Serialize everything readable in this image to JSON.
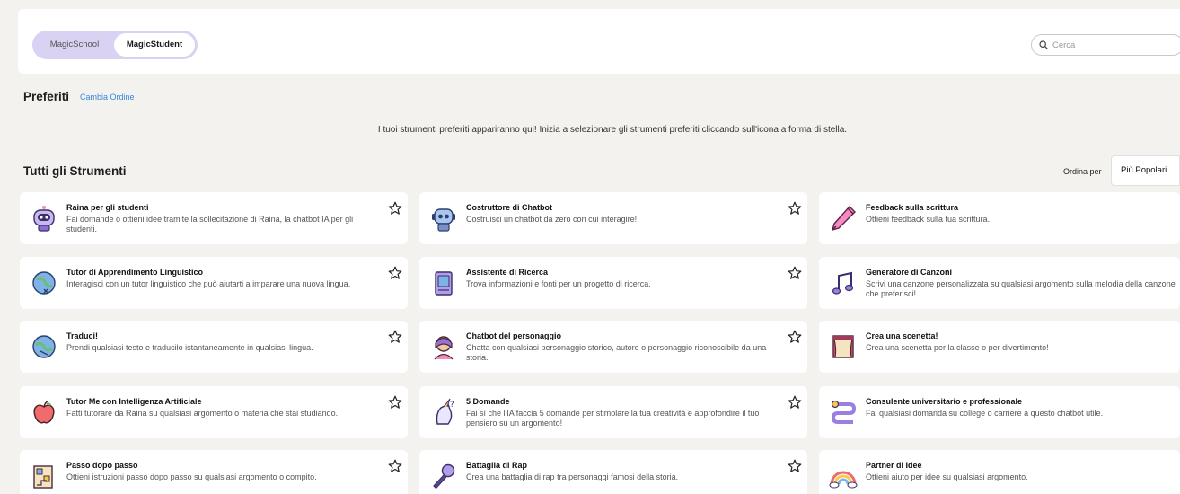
{
  "header": {
    "toggle": {
      "left_label": "MagicSchool",
      "right_label": "MagicStudent"
    },
    "search": {
      "placeholder": "Cerca"
    }
  },
  "favorites": {
    "title": "Preferiti",
    "change_order": "Cambia Ordine",
    "empty_message": "I tuoi strumenti preferiti appariranno qui! Inizia a selezionare gli strumenti preferiti cliccando sull'icona a forma di stella."
  },
  "tools": {
    "title": "Tutti gli Strumenti",
    "sort_label": "Ordina per",
    "sort_value": "Più Popolari",
    "cards": [
      {
        "title": "Raina per gli studenti",
        "desc": "Fai domande o ottieni idee tramite la sollecitazione di Raina, la chatbot IA per gli studenti.",
        "icon": "raina-robot-icon"
      },
      {
        "title": "Costruttore di Chatbot",
        "desc": "Costruisci un chatbot da zero con cui interagire!",
        "icon": "chatbot-robot-icon"
      },
      {
        "title": "Feedback sulla scrittura",
        "desc": "Ottieni feedback sulla tua scrittura.",
        "icon": "pen-icon"
      },
      {
        "title": "Tutor di Apprendimento Linguistico",
        "desc": "Interagisci con un tutor linguistico che può aiutarti a imparare una nuova lingua.",
        "icon": "globe-icon"
      },
      {
        "title": "Assistente di Ricerca",
        "desc": "Trova informazioni e fonti per un progetto di ricerca.",
        "icon": "research-book-icon"
      },
      {
        "title": "Generatore di Canzoni",
        "desc": "Scrivi una canzone personalizzata su qualsiasi argomento sulla melodia della canzone che preferisci!",
        "icon": "music-note-icon"
      },
      {
        "title": "Traduci!",
        "desc": "Prendi qualsiasi testo e traducilo istantaneamente in qualsiasi lingua.",
        "icon": "globe-translate-icon"
      },
      {
        "title": "Chatbot del personaggio",
        "desc": "Chatta con qualsiasi personaggio storico, autore o personaggio riconoscibile da una storia.",
        "icon": "character-icon"
      },
      {
        "title": "Crea una scenetta!",
        "desc": "Crea una scenetta per la classe o per divertimento!",
        "icon": "theater-curtain-icon"
      },
      {
        "title": "Tutor Me con Intelligenza Artificiale",
        "desc": "Fatti tutorare da Raina su qualsiasi argomento o materia che stai studiando.",
        "icon": "apple-icon"
      },
      {
        "title": "5 Domande",
        "desc": "Fai sì che l'IA faccia 5 domande per stimolare la tua creatività e approfondire il tuo pensiero su un argomento!",
        "icon": "unicorn-question-icon"
      },
      {
        "title": "Consulente universitario e professionale",
        "desc": "Fai qualsiasi domanda su college o carriere a questo chatbot utile.",
        "icon": "path-icon"
      },
      {
        "title": "Passo dopo passo",
        "desc": "Ottieni istruzioni passo dopo passo su qualsiasi argomento o compito.",
        "icon": "steps-icon"
      },
      {
        "title": "Battaglia di Rap",
        "desc": "Crea una battaglia di rap tra personaggi famosi della storia.",
        "icon": "microphone-icon"
      },
      {
        "title": "Partner di Idee",
        "desc": "Ottieni aiuto per idee su qualsiasi argomento.",
        "icon": "rainbow-icon"
      }
    ]
  }
}
